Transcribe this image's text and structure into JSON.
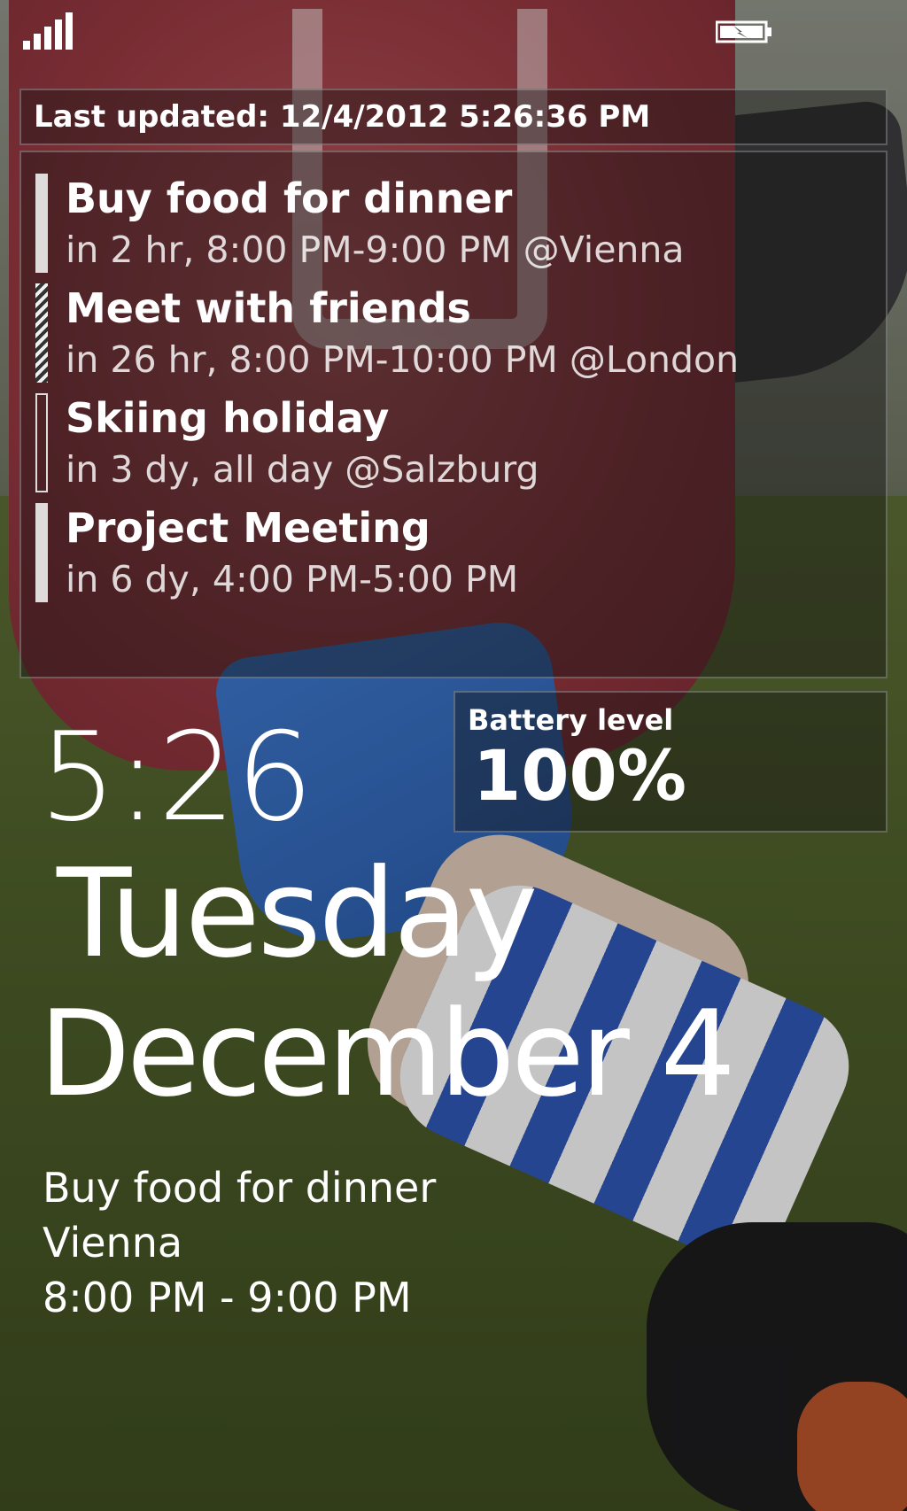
{
  "status": {
    "signal_icon": "signal-bars-icon",
    "battery_icon": "battery-charging-icon"
  },
  "updated": {
    "text": "Last updated: 12/4/2012 5:26:36 PM"
  },
  "events": [
    {
      "title": "Buy food for dinner",
      "detail": "in 2 hr, 8:00 PM-9:00 PM @Vienna",
      "status": "busy"
    },
    {
      "title": "Meet with friends",
      "detail": "in 26 hr, 8:00 PM-10:00 PM @London",
      "status": "tentative"
    },
    {
      "title": "Skiing holiday",
      "detail": "in 3 dy, all day @Salzburg",
      "status": "free"
    },
    {
      "title": "Project Meeting",
      "detail": "in 6 dy, 4:00 PM-5:00 PM",
      "status": "busy"
    }
  ],
  "battery": {
    "label": "Battery level",
    "value": "100%"
  },
  "clock": {
    "time": "5:26",
    "day": "Tuesday",
    "date": "December 4"
  },
  "next_event": {
    "title": "Buy food for dinner",
    "location": "Vienna",
    "time": "8:00 PM - 9:00 PM"
  }
}
